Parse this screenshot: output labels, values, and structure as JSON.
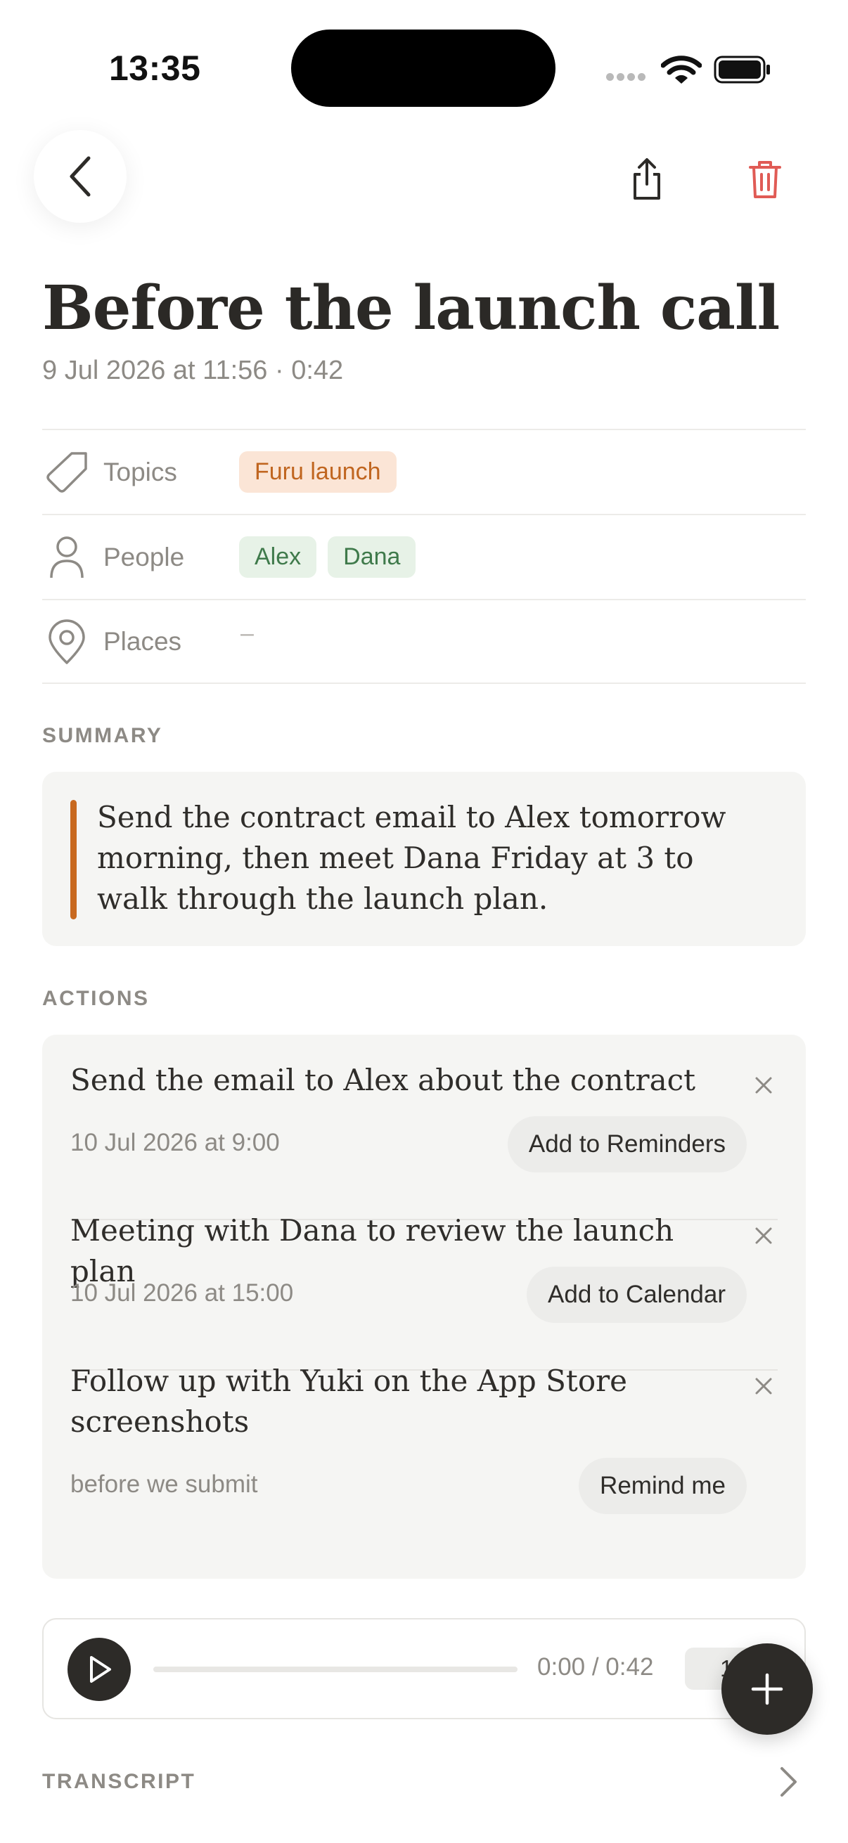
{
  "status_bar": {
    "time": "13:35"
  },
  "note": {
    "title": "Before the launch call",
    "subtitle": "9 Jul 2026 at 11:56 · 0:42"
  },
  "meta": {
    "topics": {
      "label": "Topics",
      "items": [
        "Furu launch"
      ]
    },
    "people": {
      "label": "People",
      "items": [
        "Alex",
        "Dana"
      ]
    },
    "places": {
      "label": "Places",
      "empty": "–"
    }
  },
  "summary": {
    "heading": "SUMMARY",
    "text": "Send the contract email to Alex tomorrow morning, then meet Dana Friday at 3 to walk through the launch plan."
  },
  "actions": {
    "heading": "ACTIONS",
    "items": [
      {
        "title": "Send the email to Alex about the contract",
        "meta": "10 Jul 2026 at 9:00",
        "button": "Add to Reminders"
      },
      {
        "title": "Meeting with Dana to review the launch plan",
        "meta": "10 Jul 2026 at 15:00",
        "button": "Add to Calendar"
      },
      {
        "title": "Follow up with Yuki on the App Store screenshots",
        "meta": "before we submit",
        "button": "Remind me"
      }
    ]
  },
  "player": {
    "time": "0:00 / 0:42",
    "speed": "1",
    "progress": 0
  },
  "transcript": {
    "heading": "TRANSCRIPT"
  },
  "colors": {
    "accent": "#c8691f",
    "danger": "#e05b55",
    "topic_chip_bg": "#fbe5d6",
    "person_chip_bg": "#e7f2e7",
    "card_bg": "#f5f5f3"
  },
  "icons": {
    "back": "chevron-left-icon",
    "share": "share-icon",
    "delete": "trash-icon",
    "topics": "tag-icon",
    "people": "person-icon",
    "places": "map-pin-icon",
    "close": "close-icon",
    "play": "play-icon",
    "add": "plus-icon",
    "transcript": "chevron-right-icon"
  }
}
